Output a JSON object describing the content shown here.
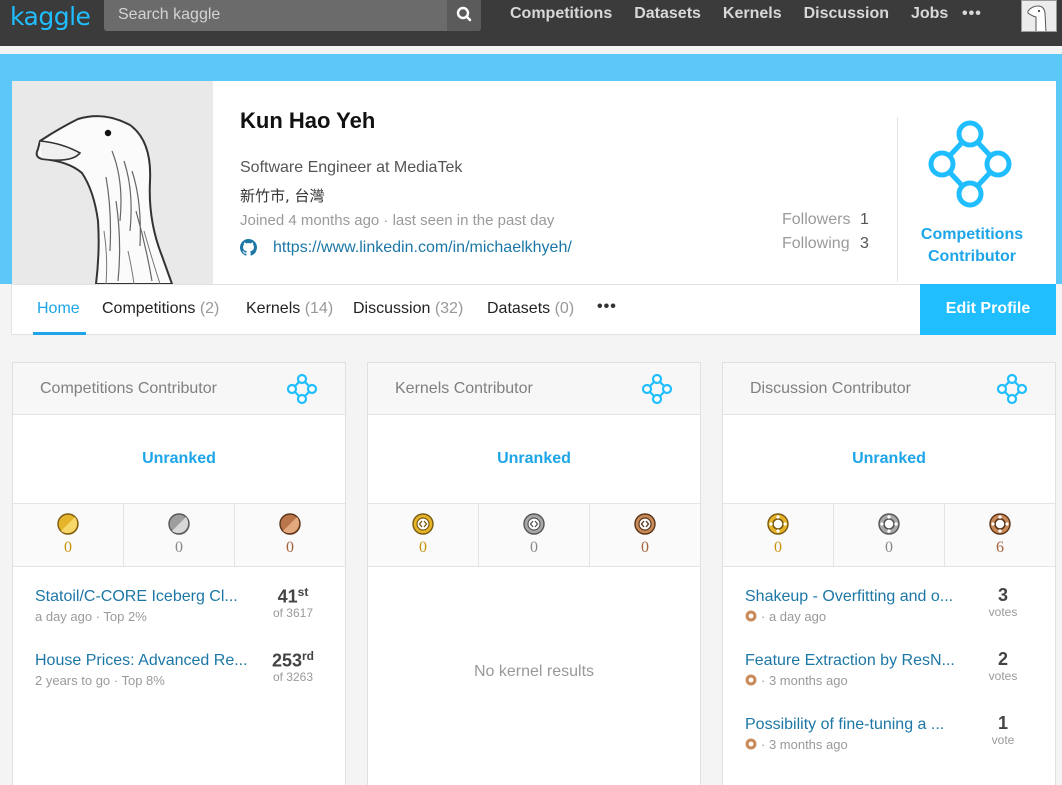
{
  "nav": {
    "logo": "kaggle",
    "search_placeholder": "Search kaggle",
    "links": [
      "Competitions",
      "Datasets",
      "Kernels",
      "Discussion",
      "Jobs"
    ],
    "more": "•••"
  },
  "profile": {
    "name": "Kun Hao Yeh",
    "occupation": "Software Engineer at MediaTek",
    "location": "新竹市, 台灣",
    "joined": "Joined 4 months ago · last seen in the past day",
    "link": "https://www.linkedin.com/in/michaelkhyeh/",
    "followers_label": "Followers",
    "followers": "1",
    "following_label": "Following",
    "following": "3",
    "tier_line1": "Competitions",
    "tier_line2": "Contributor",
    "tier_color": "#20beff"
  },
  "tabs": [
    {
      "label": "Home",
      "count": ""
    },
    {
      "label": "Competitions",
      "count": "(2)"
    },
    {
      "label": "Kernels",
      "count": "(14)"
    },
    {
      "label": "Discussion",
      "count": "(32)"
    },
    {
      "label": "Datasets",
      "count": "(0)"
    }
  ],
  "tabs_more": "•••",
  "edit_profile": "Edit Profile",
  "medal_colors": {
    "gold": "#e6b42a",
    "silver": "#a8a8a8",
    "bronze": "#c98a5a"
  },
  "panels": {
    "competitions": {
      "title": "Competitions Contributor",
      "rank": "Unranked",
      "medals": [
        "0",
        "0",
        "0"
      ],
      "items": [
        {
          "title": "Statoil/C-CORE Iceberg Cl...",
          "sub": "a day ago · Top 2%",
          "num": "41",
          "sup": "st",
          "under": "of 3617"
        },
        {
          "title": "House Prices: Advanced Re...",
          "sub": "2 years to go · Top 8%",
          "num": "253",
          "sup": "rd",
          "under": "of 3263"
        }
      ]
    },
    "kernels": {
      "title": "Kernels Contributor",
      "rank": "Unranked",
      "medals": [
        "0",
        "0",
        "0"
      ],
      "empty": "No kernel results"
    },
    "discussion": {
      "title": "Discussion Contributor",
      "rank": "Unranked",
      "medals": [
        "0",
        "0",
        "6"
      ],
      "items": [
        {
          "title": "Shakeup - Overfitting and o...",
          "sub": "· a day ago",
          "num": "3",
          "under": "votes"
        },
        {
          "title": "Feature Extraction by ResN...",
          "sub": "· 3 months ago",
          "num": "2",
          "under": "votes"
        },
        {
          "title": "Possibility of fine-tuning a ...",
          "sub": "· 3 months ago",
          "num": "1",
          "under": "vote"
        }
      ]
    }
  }
}
